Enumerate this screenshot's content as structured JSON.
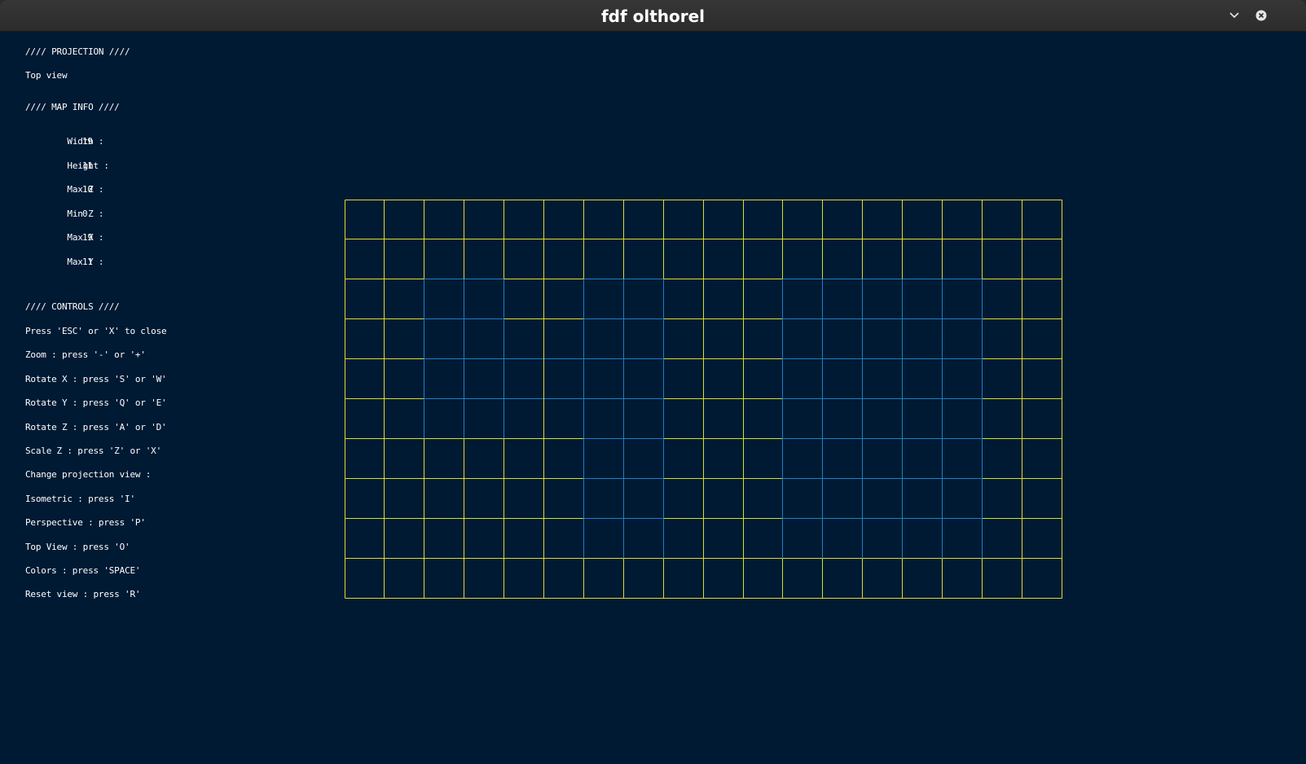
{
  "window": {
    "title": "fdf olthorel"
  },
  "icons": {
    "minimize": "chevron-down-icon",
    "close": "close-icon"
  },
  "projection": {
    "header": "//// PROJECTION ////",
    "value": "Top view"
  },
  "map_info": {
    "header": "//// MAP INFO ////",
    "items": [
      {
        "label": "Width :",
        "value": "19"
      },
      {
        "label": "Height :",
        "value": "11"
      },
      {
        "label": "Max Z :",
        "value": "10"
      },
      {
        "label": "Min Z :",
        "value": "0"
      },
      {
        "label": "Max X :",
        "value": "19"
      },
      {
        "label": "Max Y :",
        "value": "11"
      }
    ]
  },
  "controls": {
    "header": "//// CONTROLS ////",
    "lines": [
      "Press 'ESC' or 'X' to close",
      "Zoom : press '-' or '+'",
      "Rotate X : press 'S' or 'W'",
      "Rotate Y : press 'Q' or 'E'",
      "Rotate Z : press 'A' or 'D'",
      "Scale Z : press 'Z' or 'X'",
      "Change projection view :",
      "Isometric : press 'I'",
      "Perspective : press 'P'",
      "Top View : press 'O'",
      "Colors : press 'SPACE'",
      "Reset view : press 'R'"
    ]
  },
  "colors": {
    "background": "#001a33",
    "base_line": "#d4e02a",
    "elevated_line": "#1e7fc4"
  }
}
